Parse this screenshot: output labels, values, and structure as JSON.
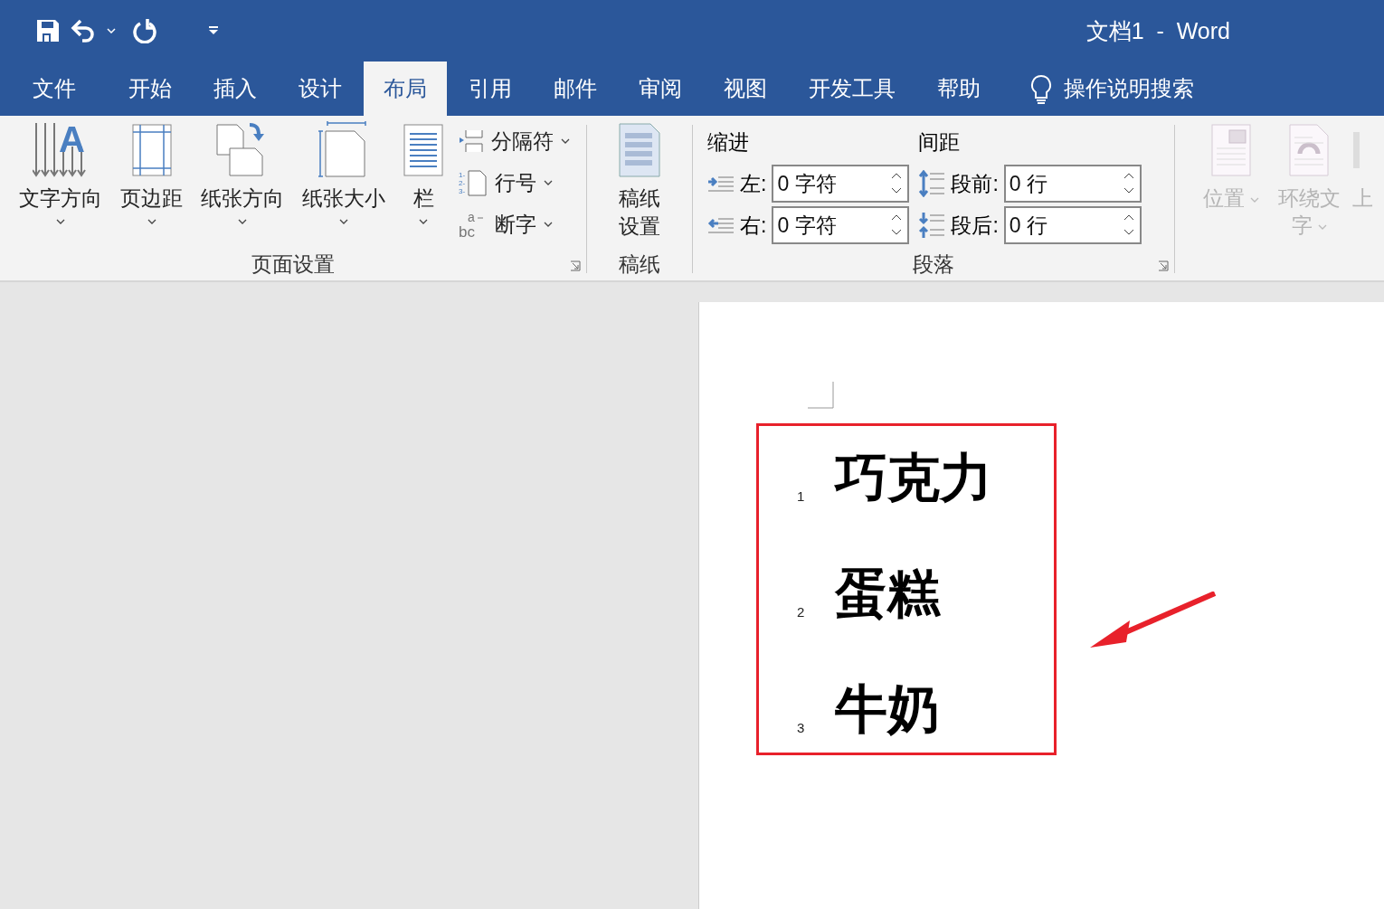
{
  "quick_access": [
    {
      "kind": "save"
    },
    {
      "kind": "undo"
    },
    {
      "kind": "dropdown"
    },
    {
      "kind": "redo"
    },
    {
      "kind": "customize"
    }
  ],
  "window": {
    "title": "文档1  -  Word"
  },
  "tabs": [
    {
      "label": "文件",
      "selected": false
    },
    {
      "label": "开始",
      "selected": false
    },
    {
      "label": "插入",
      "selected": false
    },
    {
      "label": "设计",
      "selected": false
    },
    {
      "label": "布局",
      "selected": true
    },
    {
      "label": "引用",
      "selected": false
    },
    {
      "label": "邮件",
      "selected": false
    },
    {
      "label": "审阅",
      "selected": false
    },
    {
      "label": "视图",
      "selected": false
    },
    {
      "label": "开发工具",
      "selected": false
    },
    {
      "label": "帮助",
      "selected": false
    }
  ],
  "search": {
    "label": "操作说明搜索"
  },
  "page_setup": {
    "label": "页面设置",
    "large_buttons": [
      {
        "label": "文字方向",
        "kind": "text-direction",
        "glyphs": [
          "A"
        ]
      },
      {
        "label": "页边距",
        "kind": "margins"
      },
      {
        "label": "纸张方向",
        "kind": "orientation"
      },
      {
        "label": "纸张大小",
        "kind": "size"
      },
      {
        "label": "栏",
        "kind": "columns"
      }
    ],
    "small_buttons": [
      {
        "label": "分隔符",
        "kind": "breaks"
      },
      {
        "label": "行号",
        "kind": "line-numbers",
        "glyphs": [
          "1-",
          "2-",
          "3-"
        ]
      },
      {
        "label": "断字",
        "kind": "hyphenation",
        "glyphs": [
          "a",
          "bc"
        ]
      }
    ]
  },
  "manuscript": {
    "button": "稿纸设置",
    "label": "稿纸"
  },
  "paragraph": {
    "label": "段落",
    "indent_label": "缩进",
    "spacing_label": "间距",
    "indent": [
      {
        "kind": "left",
        "label": "左:",
        "value": "0 字符"
      },
      {
        "kind": "right",
        "label": "右:",
        "value": "0 字符"
      }
    ],
    "spacing": [
      {
        "kind": "before",
        "label": "段前:",
        "value": "0 行"
      },
      {
        "kind": "after",
        "label": "段后:",
        "value": "0 行"
      }
    ]
  },
  "arrange": {
    "buttons": [
      {
        "label": "位置",
        "kind": "position",
        "disabled": true
      },
      {
        "label": "环绕文字",
        "kind": "wrap",
        "disabled": true
      },
      {
        "label": "上",
        "kind": "cut",
        "disabled": true
      }
    ]
  },
  "document": {
    "lines": [
      {
        "number": "1",
        "text": "巧克力"
      },
      {
        "number": "2",
        "text": "蛋糕"
      },
      {
        "number": "3",
        "text": "牛奶"
      }
    ]
  }
}
